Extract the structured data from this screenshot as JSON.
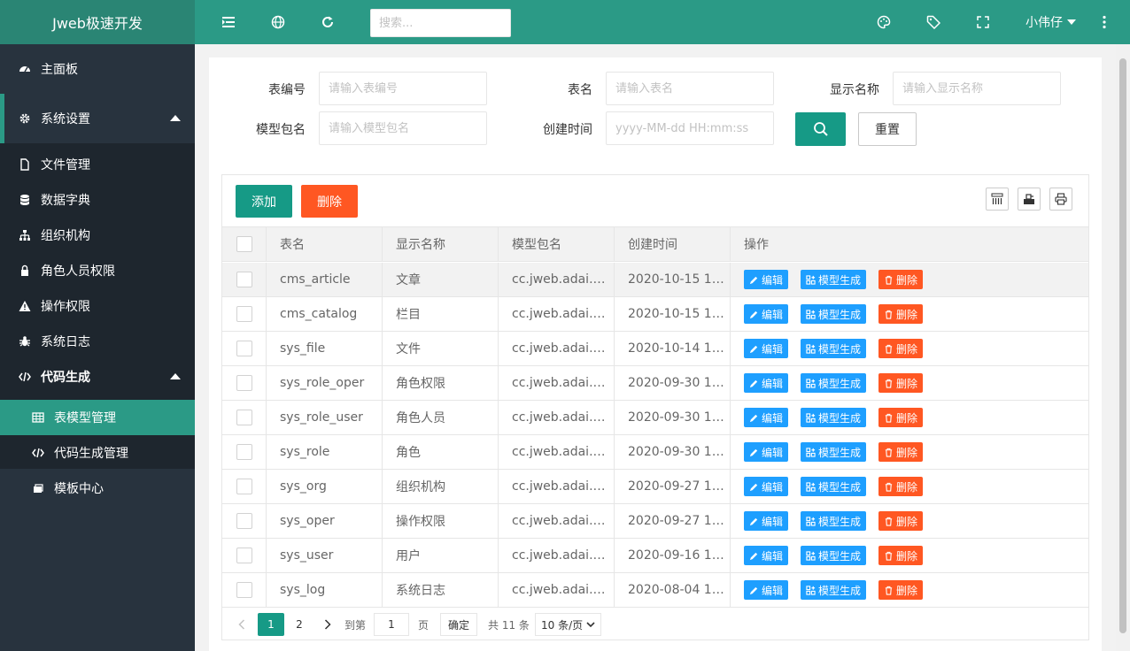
{
  "app": {
    "title": "Jweb极速开发",
    "search_placeholder": "搜索...",
    "user": "小伟仔"
  },
  "sidebar": {
    "items": [
      {
        "label": "主面板",
        "icon": "dashboard-icon"
      },
      {
        "label": "系统设置",
        "icon": "gear-icon"
      },
      {
        "label": "文件管理",
        "icon": "file-icon"
      },
      {
        "label": "数据字典",
        "icon": "database-icon"
      },
      {
        "label": "组织机构",
        "icon": "sitemap-icon"
      },
      {
        "label": "角色人员权限",
        "icon": "user-lock-icon"
      },
      {
        "label": "操作权限",
        "icon": "warning-icon"
      },
      {
        "label": "系统日志",
        "icon": "bug-icon"
      },
      {
        "label": "代码生成",
        "icon": "code-icon"
      },
      {
        "label": "表模型管理",
        "icon": "table-icon"
      },
      {
        "label": "代码生成管理",
        "icon": "code-icon"
      },
      {
        "label": "模板中心",
        "icon": "template-icon"
      }
    ]
  },
  "filters": {
    "table_id_label": "表编号",
    "table_id_placeholder": "请输入表编号",
    "table_name_label": "表名",
    "table_name_placeholder": "请输入表名",
    "display_label": "显示名称",
    "display_placeholder": "请输入显示名称",
    "package_label": "模型包名",
    "package_placeholder": "请输入模型包名",
    "created_label": "创建时间",
    "created_placeholder": "yyyy-MM-dd HH:mm:ss",
    "reset_label": "重置"
  },
  "toolbar": {
    "add_label": "添加",
    "delete_label": "删除"
  },
  "table": {
    "headers": [
      "表名",
      "显示名称",
      "模型包名",
      "创建时间",
      "操作"
    ],
    "actions": {
      "edit": "编辑",
      "generate": "模型生成",
      "delete": "删除"
    },
    "rows": [
      {
        "name": "cms_article",
        "display": "文章",
        "package": "cc.jweb.adai.…",
        "created": "2020-10-15 1…"
      },
      {
        "name": "cms_catalog",
        "display": "栏目",
        "package": "cc.jweb.adai.…",
        "created": "2020-10-15 1…"
      },
      {
        "name": "sys_file",
        "display": "文件",
        "package": "cc.jweb.adai.…",
        "created": "2020-10-14 1…"
      },
      {
        "name": "sys_role_oper",
        "display": "角色权限",
        "package": "cc.jweb.adai.…",
        "created": "2020-09-30 1…"
      },
      {
        "name": "sys_role_user",
        "display": "角色人员",
        "package": "cc.jweb.adai.…",
        "created": "2020-09-30 1…"
      },
      {
        "name": "sys_role",
        "display": "角色",
        "package": "cc.jweb.adai.…",
        "created": "2020-09-30 1…"
      },
      {
        "name": "sys_org",
        "display": "组织机构",
        "package": "cc.jweb.adai.…",
        "created": "2020-09-27 1…"
      },
      {
        "name": "sys_oper",
        "display": "操作权限",
        "package": "cc.jweb.adai.…",
        "created": "2020-09-27 1…"
      },
      {
        "name": "sys_user",
        "display": "用户",
        "package": "cc.jweb.adai.…",
        "created": "2020-09-16 1…"
      },
      {
        "name": "sys_log",
        "display": "系统日志",
        "package": "cc.jweb.adai.…",
        "created": "2020-08-04 1…"
      }
    ]
  },
  "pager": {
    "current": "1",
    "page2": "2",
    "goto_label": "到第",
    "goto_value": "1",
    "page_unit": "页",
    "confirm": "确定",
    "total": "共 11 条",
    "page_size": "10 条/页"
  },
  "colors": {
    "primary": "#169a86",
    "header": "#2b9a86",
    "sidebar": "#28333e",
    "danger": "#ff5722",
    "info": "#1e9fff"
  }
}
